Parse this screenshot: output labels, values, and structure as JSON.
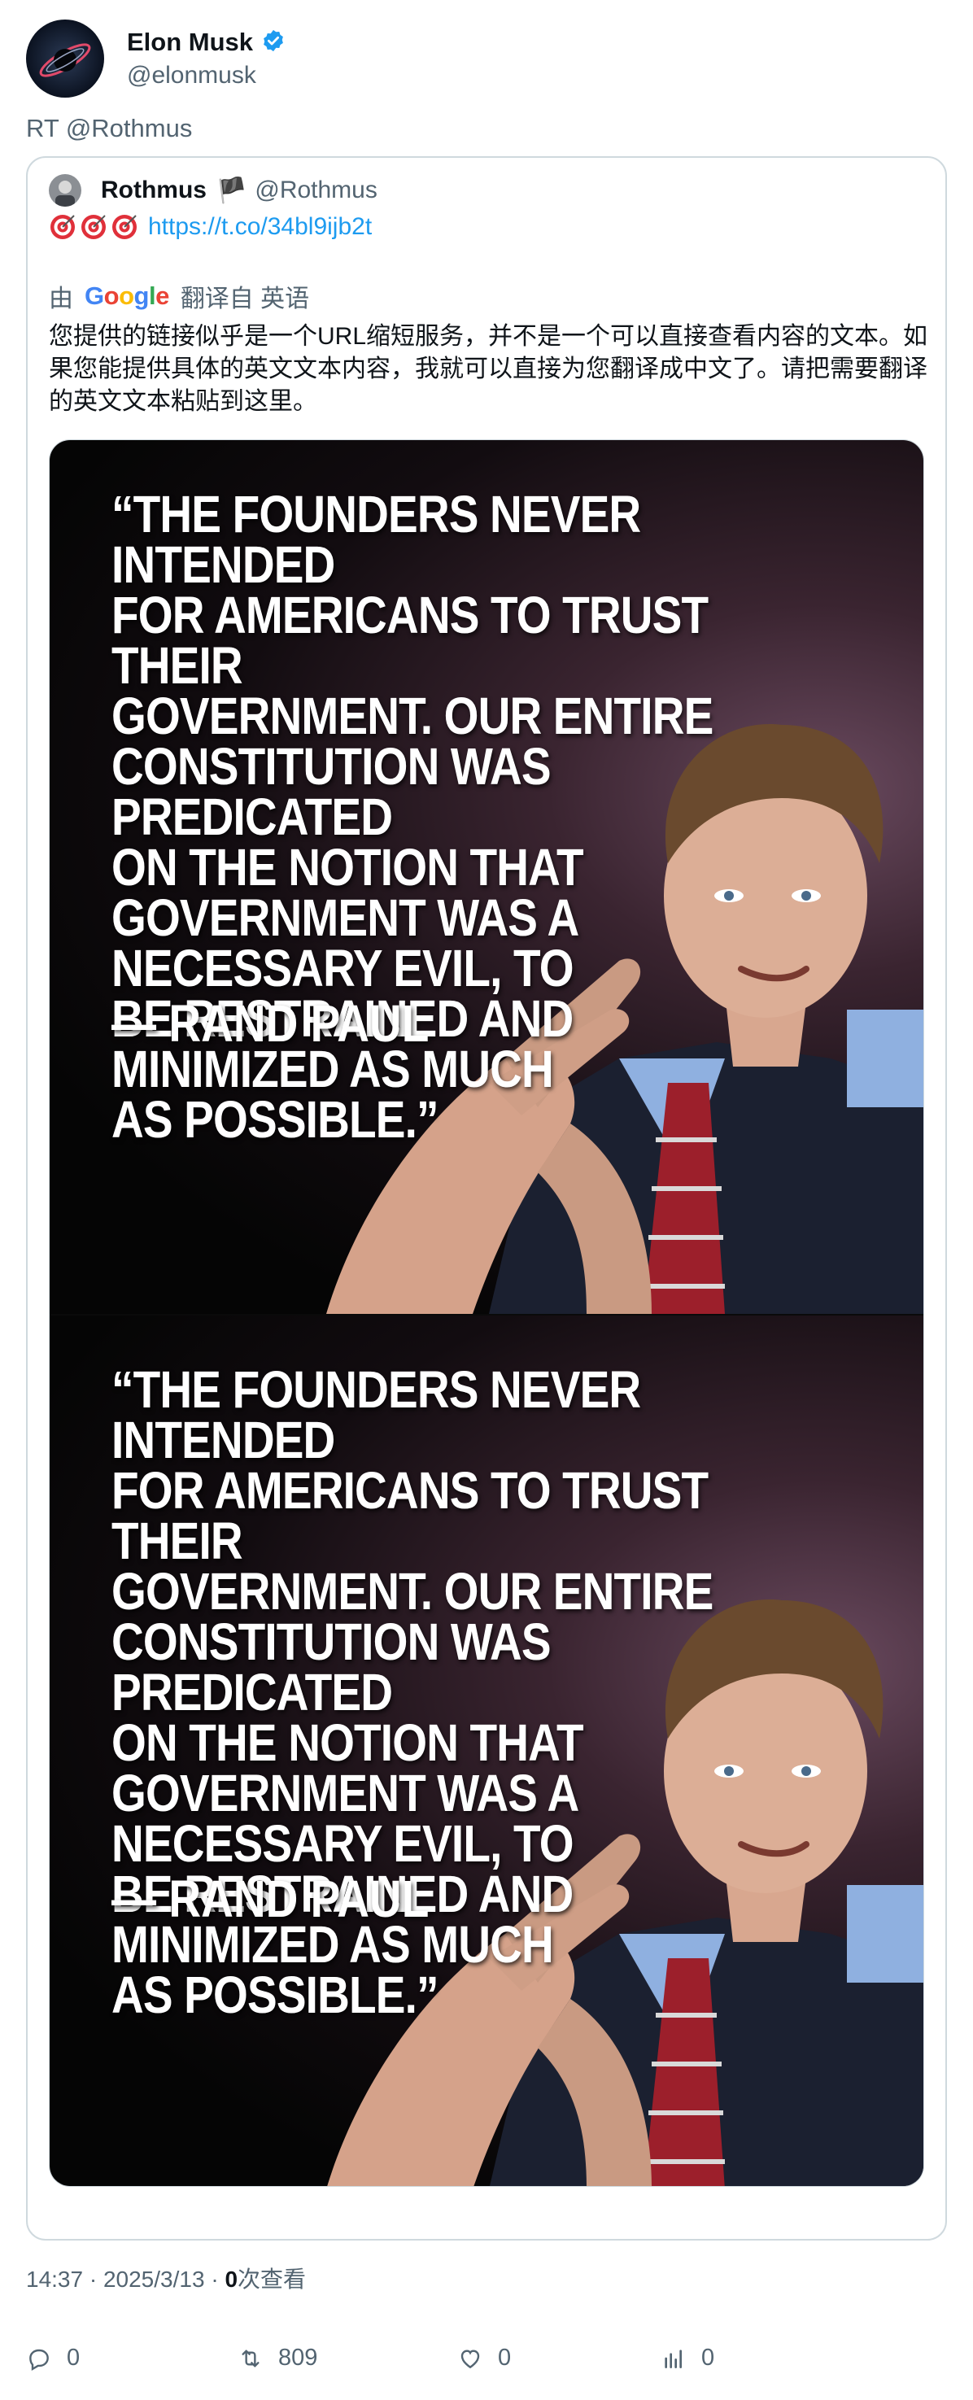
{
  "author": {
    "display_name": "Elon Musk",
    "handle": "@elonmusk",
    "verified": true,
    "verified_color": "#1d9bf0"
  },
  "retweet_text": "RT @Rothmus",
  "quoted": {
    "display_name": "Rothmus",
    "flag_emoji": "🏴",
    "handle": "@Rothmus",
    "link": "https://t.co/34bl9ijb2t",
    "target_icons": [
      "direct-hit-icon",
      "direct-hit-icon",
      "direct-hit-icon"
    ],
    "translation": {
      "prefix": "由",
      "provider_letters": [
        "G",
        "o",
        "o",
        "g",
        "l",
        "e"
      ],
      "suffix": "翻译自 英语",
      "text": "您提供的链接似乎是一个URL缩短服务，并不是一个可以直接查看内容的文本。如果您能提供具体的英文文本内容，我就可以直接为您翻译成中文了。请把需要翻译的英文文本粘贴到这里。"
    },
    "media": [
      {
        "quote_lines": [
          "“THE FOUNDERS NEVER INTENDED",
          "FOR AMERICANS TO TRUST THEIR",
          "GOVERNMENT. OUR ENTIRE",
          "CONSTITUTION WAS PREDICATED",
          "ON THE NOTION THAT",
          "GOVERNMENT WAS A",
          "NECESSARY EVIL, TO",
          "BE RESTRAINED AND",
          "MINIMIZED AS MUCH",
          "AS POSSIBLE.”"
        ],
        "attribution": "— RAND PAUL"
      },
      {
        "quote_lines": [
          "“THE FOUNDERS NEVER INTENDED",
          "FOR AMERICANS TO TRUST THEIR",
          "GOVERNMENT. OUR ENTIRE",
          "CONSTITUTION WAS PREDICATED",
          "ON THE NOTION THAT",
          "GOVERNMENT WAS A",
          "NECESSARY EVIL, TO",
          "BE RESTRAINED AND",
          "MINIMIZED AS MUCH",
          "AS POSSIBLE.”"
        ],
        "attribution": "— RAND PAUL"
      }
    ]
  },
  "meta": {
    "time": "14:37",
    "separator": " · ",
    "date": "2025/3/13",
    "views_count": "0",
    "views_label": "次查看"
  },
  "actions": {
    "replies": "0",
    "retweets": "809",
    "likes": "0",
    "views": "0"
  }
}
